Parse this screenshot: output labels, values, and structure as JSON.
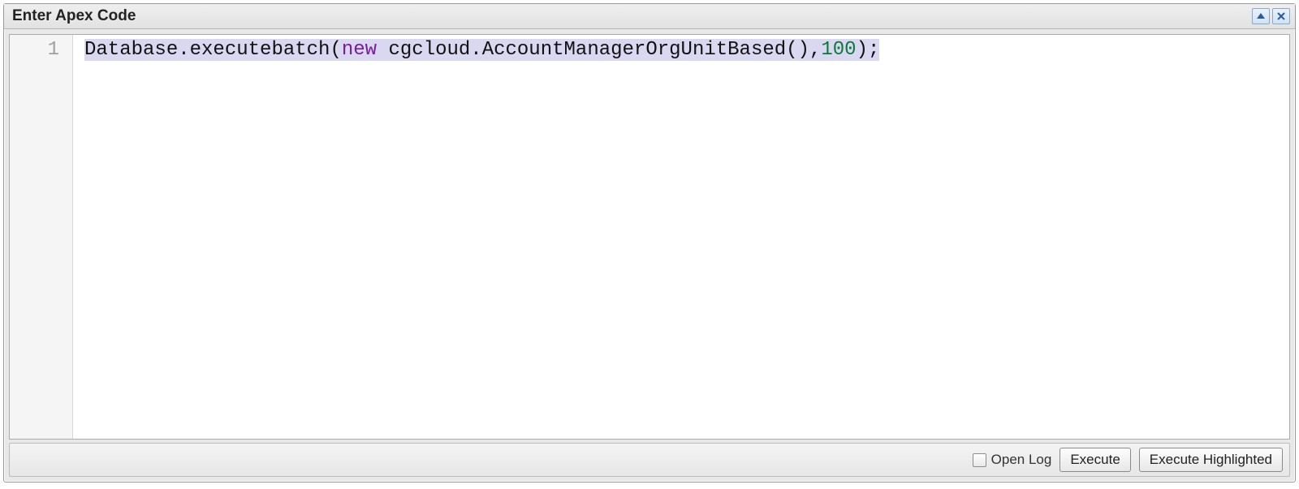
{
  "window": {
    "title": "Enter Apex Code"
  },
  "editor": {
    "line_number": "1",
    "code": {
      "seg1": "Database.executebatch(",
      "kw_new": "new",
      "seg2": " cgcloud.AccountManagerOrgUnitBased(),",
      "num": "100",
      "seg3": ");"
    }
  },
  "footer": {
    "open_log_label": "Open Log",
    "execute_label": "Execute",
    "execute_highlighted_label": "Execute Highlighted"
  }
}
